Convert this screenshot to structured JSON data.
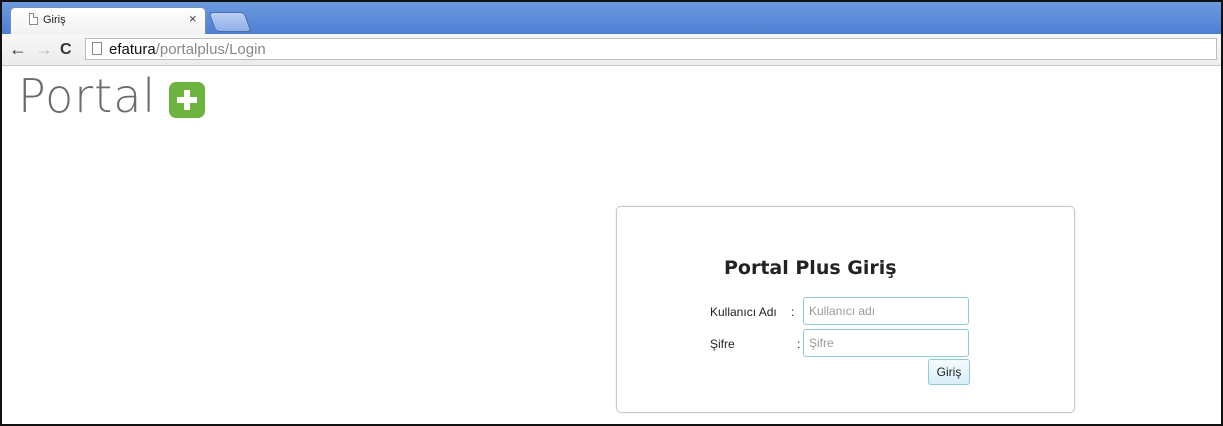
{
  "browser": {
    "tab_title": "Giriş",
    "tab_close": "×",
    "back": "←",
    "forward": "→",
    "reload": "C",
    "url_host": "efatura",
    "url_path": "/portalplus/Login"
  },
  "logo": {
    "text": "Portal",
    "plus_icon": "plus-icon",
    "accent_color": "#6cb33f"
  },
  "login": {
    "title": "Portal Plus Giriş",
    "username_label": "Kullanıcı Adı",
    "username_colon": ":",
    "username_placeholder": "Kullanıcı adı",
    "password_label": "Şifre",
    "password_colon": ":",
    "password_placeholder": "Şifre",
    "submit_label": "Giriş"
  }
}
